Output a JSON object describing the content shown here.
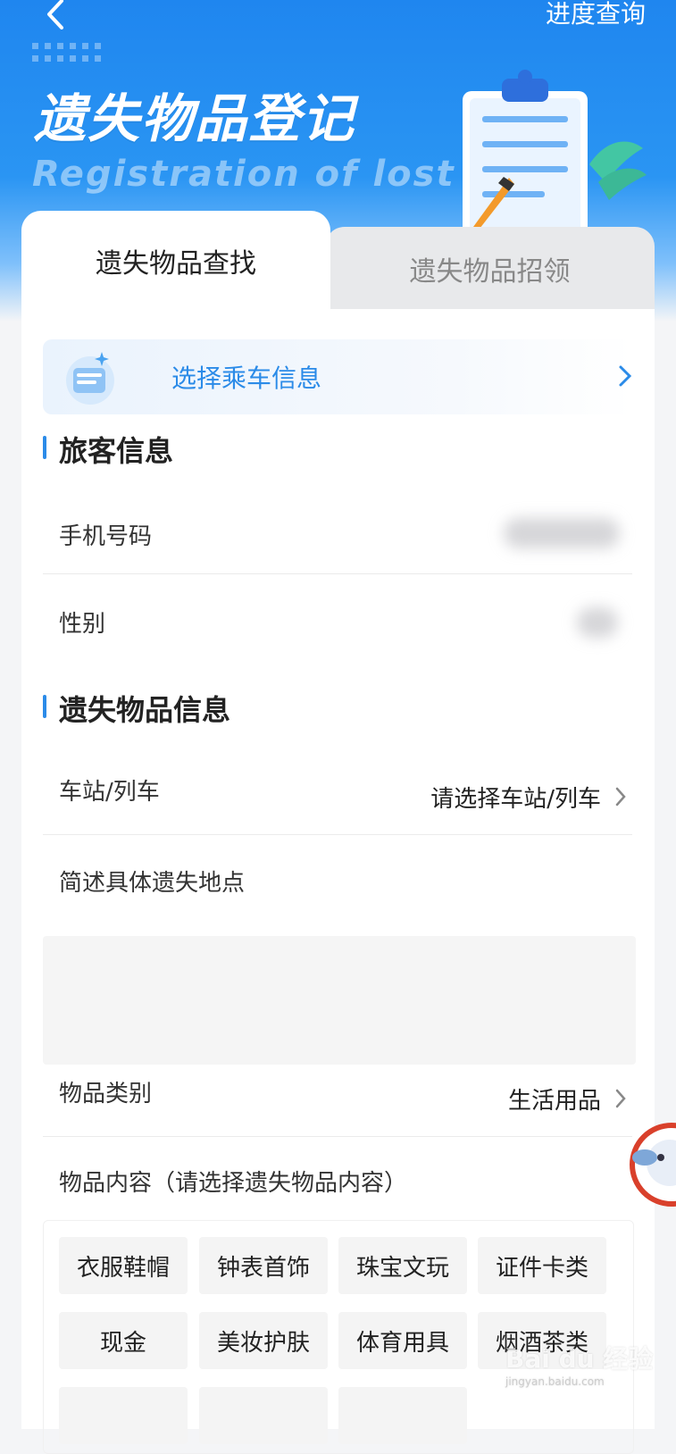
{
  "header": {
    "progress_label": "进度查询",
    "title": "遗失物品登记",
    "subtitle": "Registration of lost"
  },
  "tabs": [
    {
      "label": "遗失物品查找",
      "active": true
    },
    {
      "label": "遗失物品招领",
      "active": false
    }
  ],
  "trip": {
    "label": "选择乘车信息"
  },
  "passenger": {
    "section_title": "旅客信息",
    "phone_label": "手机号码",
    "gender_label": "性别"
  },
  "lost_item": {
    "section_title": "遗失物品信息",
    "station_label": "车站/列车",
    "station_value": "请选择车站/列车",
    "location_label": "简述具体遗失地点",
    "location_value": "",
    "category_label": "物品类别",
    "category_value": "生活用品",
    "content_label": "物品内容（请选择遗失物品内容）",
    "content_options": [
      "衣服鞋帽",
      "钟表首饰",
      "珠宝文玩",
      "证件卡类",
      "现金",
      "美妆护肤",
      "体育用具",
      "烟酒茶类"
    ]
  },
  "watermark": {
    "text": "Bai du 经验",
    "sub": "jingyan.baidu.com"
  },
  "colors": {
    "accent": "#2b8be8",
    "hero": "#1f86ef"
  }
}
